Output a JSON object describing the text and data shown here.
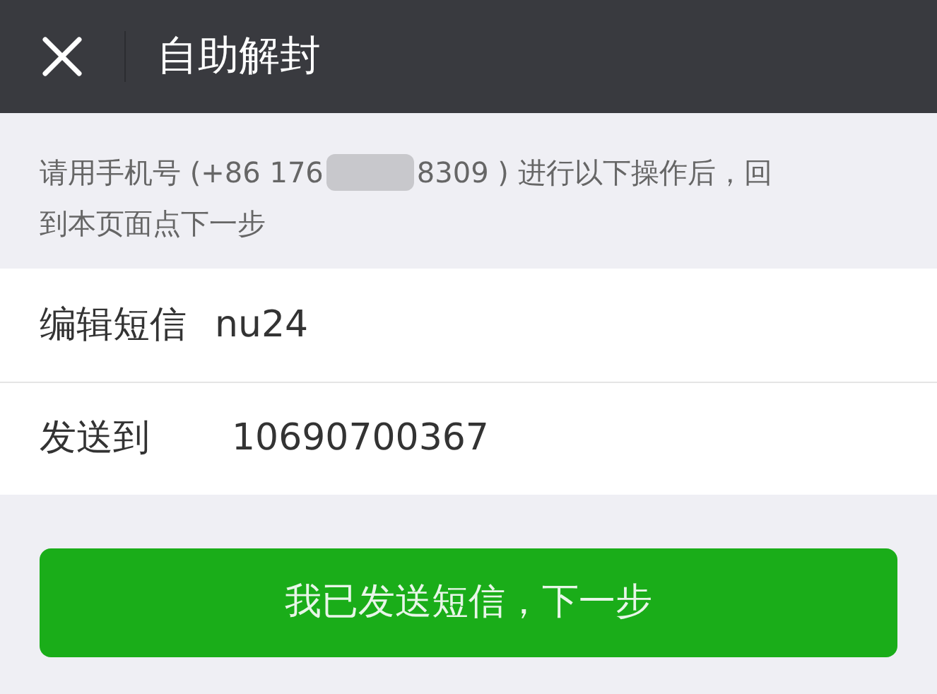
{
  "header": {
    "title": "自助解封"
  },
  "notice": {
    "before": "请用手机号 (+86 176",
    "after": "8309 ) 进行以下操作后，回",
    "second_line": "到本页面点下一步"
  },
  "fields": [
    {
      "label": "编辑短信",
      "value": "nu24"
    },
    {
      "label": "发送到",
      "value": "10690700367"
    }
  ],
  "button": {
    "label": "我已发送短信，下一步"
  }
}
